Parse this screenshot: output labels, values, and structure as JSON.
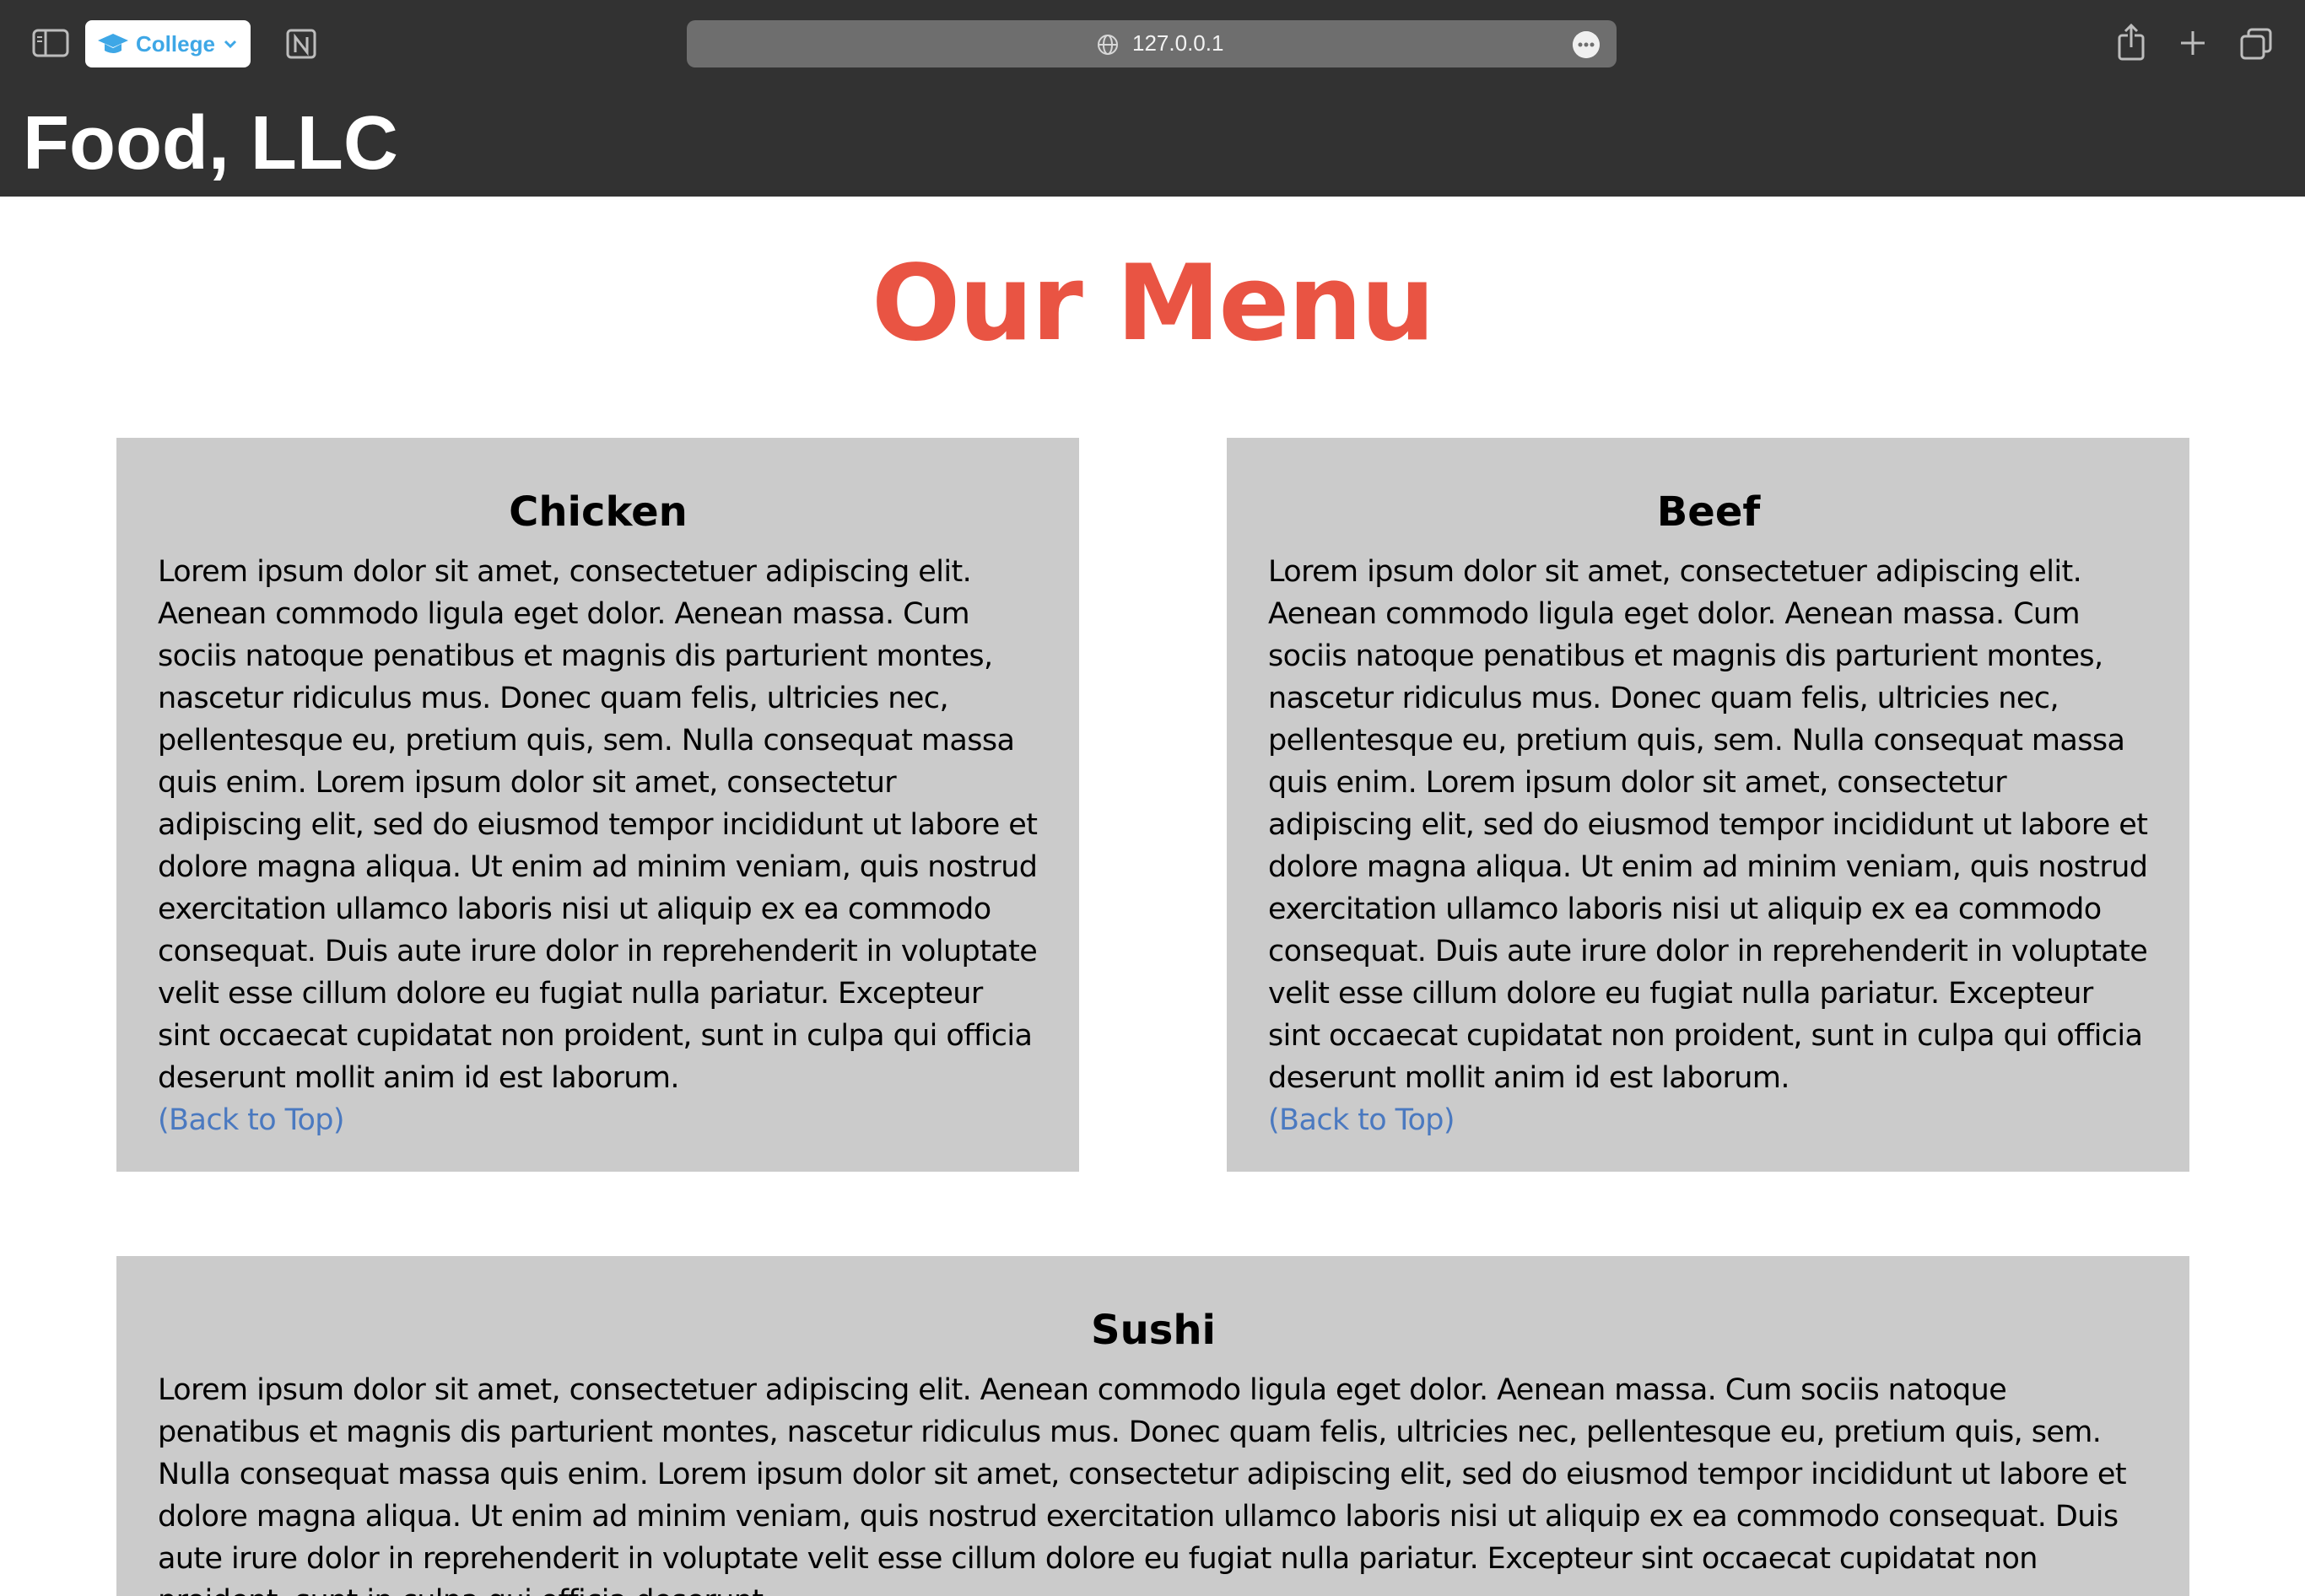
{
  "browser": {
    "tab_group": "College",
    "url": "127.0.0.1"
  },
  "site": {
    "title": "Food, LLC"
  },
  "main": {
    "heading": "Our Menu",
    "sections": [
      {
        "title": "Chicken",
        "body": "Lorem ipsum dolor sit amet, consectetuer adipiscing elit. Aenean commodo ligula eget dolor. Aenean massa. Cum sociis natoque penatibus et magnis dis parturient montes, nascetur ridiculus mus. Donec quam felis, ultricies nec, pellentesque eu, pretium quis, sem. Nulla consequat massa quis enim. Lorem ipsum dolor sit amet, consectetur adipiscing elit, sed do eiusmod tempor incididunt ut labore et dolore magna aliqua. Ut enim ad minim veniam, quis nostrud exercitation ullamco laboris nisi ut aliquip ex ea commodo consequat. Duis aute irure dolor in reprehenderit in voluptate velit esse cillum dolore eu fugiat nulla pariatur. Excepteur sint occaecat cupidatat non proident, sunt in culpa qui officia deserunt mollit anim id est laborum.",
        "link": "(Back to Top)"
      },
      {
        "title": "Beef",
        "body": "Lorem ipsum dolor sit amet, consectetuer adipiscing elit. Aenean commodo ligula eget dolor. Aenean massa. Cum sociis natoque penatibus et magnis dis parturient montes, nascetur ridiculus mus. Donec quam felis, ultricies nec, pellentesque eu, pretium quis, sem. Nulla consequat massa quis enim. Lorem ipsum dolor sit amet, consectetur adipiscing elit, sed do eiusmod tempor incididunt ut labore et dolore magna aliqua. Ut enim ad minim veniam, quis nostrud exercitation ullamco laboris nisi ut aliquip ex ea commodo consequat. Duis aute irure dolor in reprehenderit in voluptate velit esse cillum dolore eu fugiat nulla pariatur. Excepteur sint occaecat cupidatat non proident, sunt in culpa qui officia deserunt mollit anim id est laborum.",
        "link": "(Back to Top)"
      },
      {
        "title": "Sushi",
        "body": "Lorem ipsum dolor sit amet, consectetuer adipiscing elit. Aenean commodo ligula eget dolor. Aenean massa. Cum sociis natoque penatibus et magnis dis parturient montes, nascetur ridiculus mus. Donec quam felis, ultricies nec, pellentesque eu, pretium quis, sem. Nulla consequat massa quis enim. Lorem ipsum dolor sit amet, consectetur adipiscing elit, sed do eiusmod tempor incididunt ut labore et dolore magna aliqua. Ut enim ad minim veniam, quis nostrud exercitation ullamco laboris nisi ut aliquip ex ea commodo consequat. Duis aute irure dolor in reprehenderit in voluptate velit esse cillum dolore eu fugiat nulla pariatur. Excepteur sint occaecat cupidatat non proident, sunt in culpa qui officia deserunt"
      }
    ]
  },
  "colors": {
    "header_bg": "#323232",
    "heading_red": "#e95443",
    "card_bg": "#cbcbcb",
    "link_blue": "#4a79c0"
  },
  "icons": [
    "sidebar-icon",
    "graduation-cap-icon",
    "chevron-down-icon",
    "notion-icon",
    "globe-icon",
    "more-icon",
    "share-icon",
    "plus-icon",
    "tabs-icon"
  ]
}
